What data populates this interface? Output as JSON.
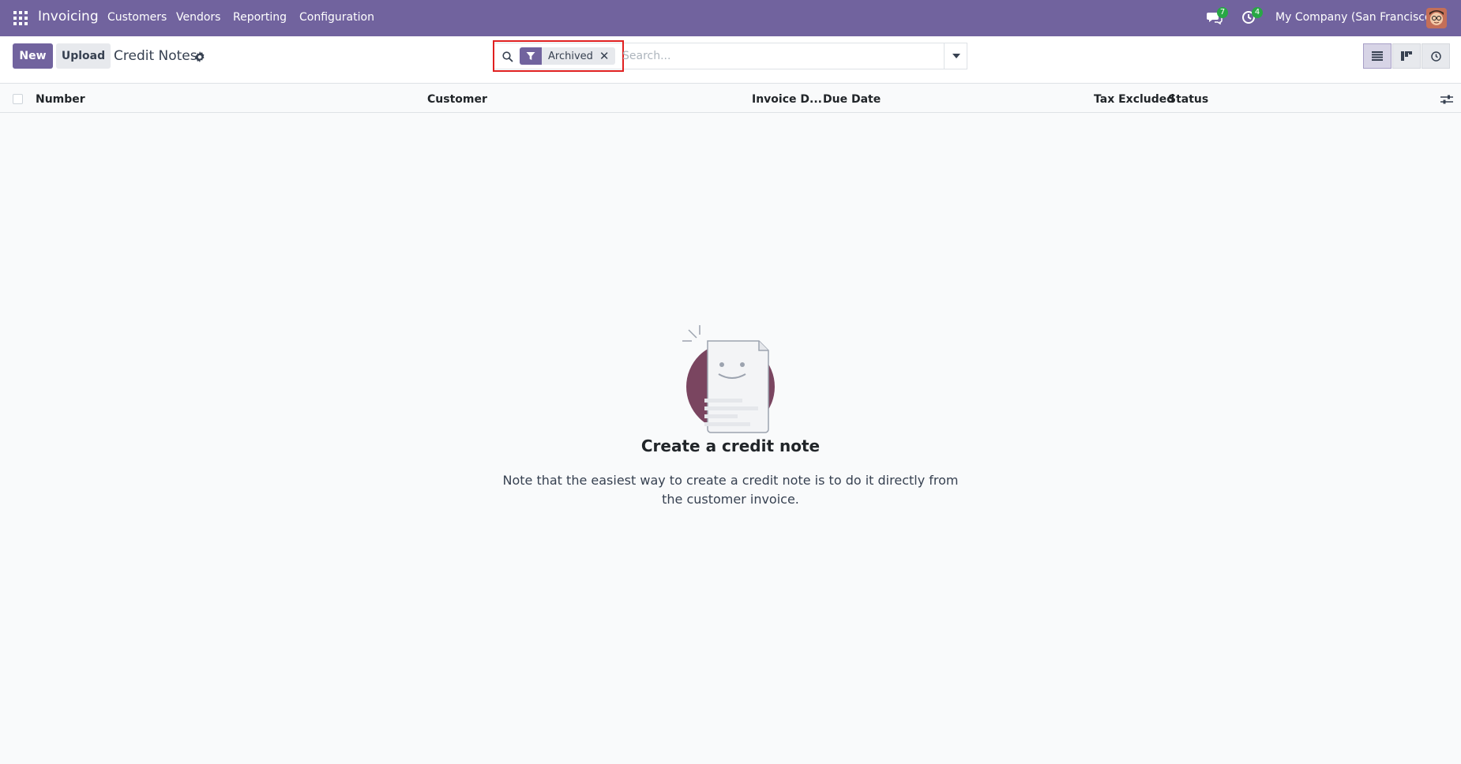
{
  "navbar": {
    "brand": "Invoicing",
    "menu": [
      "Customers",
      "Vendors",
      "Reporting",
      "Configuration"
    ],
    "messages_count": "7",
    "activities_count": "4",
    "company": "My Company (San Francisco)"
  },
  "control_panel": {
    "new_label": "New",
    "upload_label": "Upload",
    "title": "Credit Notes"
  },
  "search": {
    "facet_label": "Archived",
    "facet_remove": "✕",
    "placeholder": "Search..."
  },
  "table": {
    "columns": [
      "Number",
      "Customer",
      "Invoice D...",
      "Due Date",
      "Tax Excluded",
      "Status"
    ]
  },
  "empty_state": {
    "title": "Create a credit note",
    "text": "Note that the easiest way to create a credit note is to do it directly from the customer invoice."
  },
  "colors": {
    "brand": "#71639e",
    "highlight": "#e02020",
    "badge": "#28a745"
  }
}
